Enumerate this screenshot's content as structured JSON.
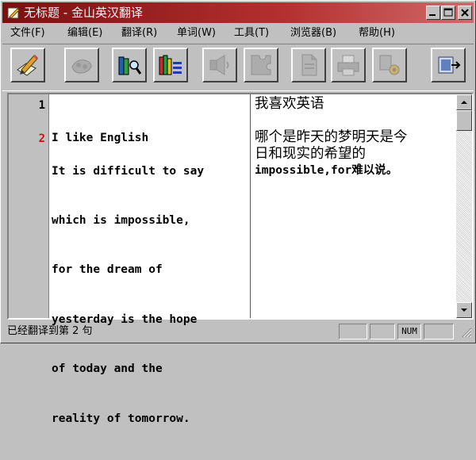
{
  "window": {
    "title": "无标题 - 金山英汉翻译"
  },
  "menu": {
    "items": [
      "文件(F)",
      "编辑(E)",
      "翻译(R)",
      "单词(W)",
      "工具(T)",
      "浏览器(B)",
      "帮助(H)"
    ]
  },
  "toolbar": {
    "buttons": [
      {
        "icon": "translate-pen-icon",
        "enabled": true
      },
      {
        "icon": "hand-tool-icon",
        "enabled": false
      },
      {
        "icon": "dictionary-search-icon",
        "enabled": true
      },
      {
        "icon": "books-list-icon",
        "enabled": true
      },
      {
        "icon": "speaker-icon",
        "enabled": false
      },
      {
        "icon": "puzzle-icon",
        "enabled": false
      },
      {
        "icon": "document-icon",
        "enabled": false
      },
      {
        "icon": "printer-icon",
        "enabled": false
      },
      {
        "icon": "settings-icon",
        "enabled": false
      },
      {
        "icon": "exit-icon",
        "enabled": true
      }
    ]
  },
  "editor": {
    "rows": [
      {
        "number": "1",
        "number_color": "#000000",
        "english": [
          "I like English"
        ],
        "chinese": [
          "我喜欢英语"
        ]
      },
      {
        "number": "2",
        "number_color": "#d01010",
        "english": [
          "It is difficult to say",
          "which is impossible,",
          "for the dream of",
          "yesterday is the hope",
          "of today and the",
          "reality of tomorrow."
        ],
        "chinese": [
          "哪个是昨天的梦明天是今",
          "日和现实的希望的",
          "impossible,for难以说。"
        ]
      }
    ]
  },
  "status": {
    "message": "已经翻译到第 2 句",
    "num_indicator": "NUM"
  },
  "colors": {
    "title_bar": "#7a1010",
    "face": "#c0c0c0"
  }
}
